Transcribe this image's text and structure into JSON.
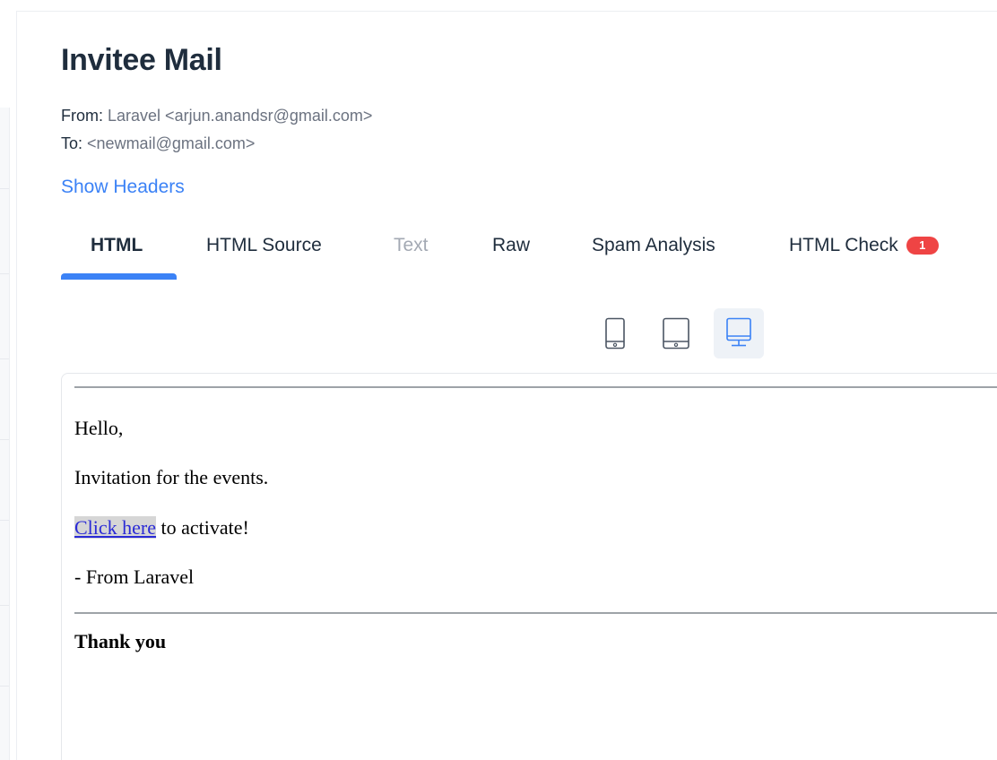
{
  "email": {
    "subject": "Invitee Mail",
    "from_label": "From:",
    "from_value": "Laravel <arjun.anandsr@gmail.com>",
    "to_label": "To:",
    "to_value": "<newmail@gmail.com>",
    "show_headers": "Show Headers"
  },
  "tabs": [
    {
      "label": "HTML",
      "active": true
    },
    {
      "label": "HTML Source"
    },
    {
      "label": "Text",
      "disabled": true
    },
    {
      "label": "Raw"
    },
    {
      "label": "Spam Analysis"
    },
    {
      "label": "HTML Check",
      "badge": "1"
    }
  ],
  "device_toggle": {
    "options": [
      {
        "icon": "phone-icon"
      },
      {
        "icon": "tablet-icon"
      },
      {
        "icon": "desktop-icon",
        "selected": true
      }
    ]
  },
  "preview": {
    "greeting": "Hello,",
    "line1": "Invitation for the events.",
    "link_text": "Click here",
    "link_suffix": " to activate!",
    "signoff": "- From Laravel",
    "thanks": "Thank you"
  },
  "colors": {
    "accent": "#3b82f6",
    "badge": "#ef4444",
    "title": "#1f2d3d",
    "muted": "#6b7280"
  }
}
